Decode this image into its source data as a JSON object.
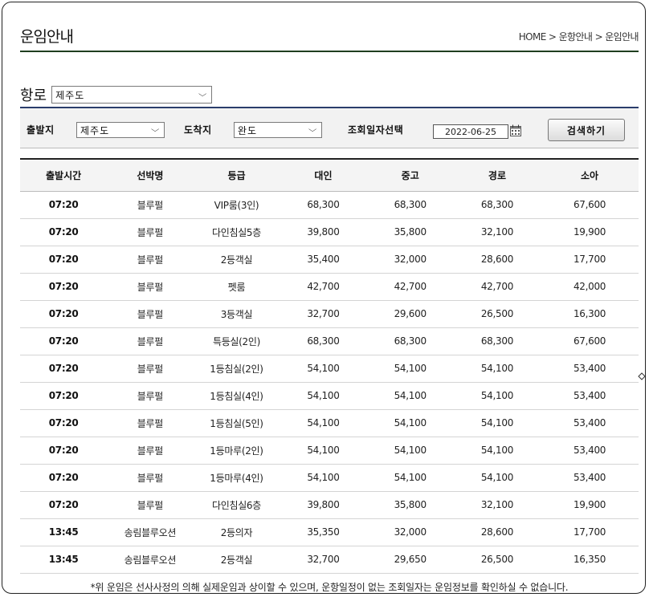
{
  "page": {
    "title": "운임안내",
    "breadcrumb": "HOME > 운항안내 > 운임안내"
  },
  "route": {
    "label": "항로",
    "selected": "제주도"
  },
  "search": {
    "departure_label": "출발지",
    "departure_value": "제주도",
    "arrival_label": "도착지",
    "arrival_value": "완도",
    "date_label": "조회일자선택",
    "date_value": "2022-06-25",
    "button_label": "검색하기"
  },
  "table": {
    "headers": [
      "출발시간",
      "선박명",
      "등급",
      "대인",
      "중고",
      "경로",
      "소아"
    ],
    "rows": [
      [
        "07:20",
        "블루펄",
        "VIP룸(3인)",
        "68,300",
        "68,300",
        "68,300",
        "67,600"
      ],
      [
        "07:20",
        "블루펄",
        "다인침실5층",
        "39,800",
        "35,800",
        "32,100",
        "19,900"
      ],
      [
        "07:20",
        "블루펄",
        "2등객실",
        "35,400",
        "32,000",
        "28,600",
        "17,700"
      ],
      [
        "07:20",
        "블루펄",
        "펫룸",
        "42,700",
        "42,700",
        "42,700",
        "42,000"
      ],
      [
        "07:20",
        "블루펄",
        "3등객실",
        "32,700",
        "29,600",
        "26,500",
        "16,300"
      ],
      [
        "07:20",
        "블루펄",
        "특등실(2인)",
        "68,300",
        "68,300",
        "68,300",
        "67,600"
      ],
      [
        "07:20",
        "블루펄",
        "1등침실(2인)",
        "54,100",
        "54,100",
        "54,100",
        "53,400"
      ],
      [
        "07:20",
        "블루펄",
        "1등침실(4인)",
        "54,100",
        "54,100",
        "54,100",
        "53,400"
      ],
      [
        "07:20",
        "블루펄",
        "1등침실(5인)",
        "54,100",
        "54,100",
        "54,100",
        "53,400"
      ],
      [
        "07:20",
        "블루펄",
        "1등마루(2인)",
        "54,100",
        "54,100",
        "54,100",
        "53,400"
      ],
      [
        "07:20",
        "블루펄",
        "1등마루(4인)",
        "54,100",
        "54,100",
        "54,100",
        "53,400"
      ],
      [
        "07:20",
        "블루펄",
        "다인침실6층",
        "39,800",
        "35,800",
        "32,100",
        "19,900"
      ],
      [
        "13:45",
        "송림블루오션",
        "2등의자",
        "35,350",
        "32,000",
        "28,600",
        "17,700"
      ],
      [
        "13:45",
        "송림블루오션",
        "2등객실",
        "32,700",
        "29,650",
        "26,500",
        "16,350"
      ]
    ]
  },
  "notice": "*위 운임은 선사사정의 의해 실제운임과 상이할 수 있으며, 운항일정이 없는 조회일자는 운임정보를 확인하실 수 없습니다.",
  "icons": {
    "dropdown": "chevron-down-icon",
    "calendar": "calendar-icon",
    "scroll": "scroll-handle-icon"
  },
  "colors": {
    "title_rule": "#1f3f1f",
    "search_bar_top": "#2a3d6b"
  }
}
